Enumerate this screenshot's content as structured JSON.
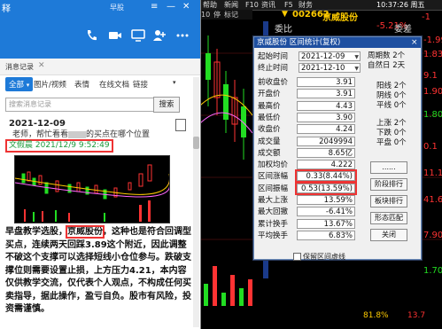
{
  "terminal": {
    "topbar": [
      "帮助",
      "新闻",
      "F10",
      "资讯",
      "F5",
      "财务"
    ],
    "toolbar2": [
      "10",
      "停",
      "标记"
    ],
    "clock": "10:37:26 周五",
    "stock_code": "002662",
    "stock_name": "京威股份",
    "weibi_label": "委比",
    "weibi_value": "-5.21%",
    "weicha_label": "委差",
    "right_values": [
      "-1.99",
      "1.83",
      "9.1",
      "1.90",
      "1.80",
      "0.1",
      "11.1",
      "41.6",
      "7.90",
      "1.70"
    ],
    "bottom_row": [
      "81.8%",
      "13.7"
    ],
    "red_up": "-1",
    "colors": {
      "bg": "#000000",
      "up": "#ff3333",
      "down": "#22dd22",
      "code": "#ffcc00"
    }
  },
  "chat": {
    "title": "释",
    "subtitle": "早股",
    "tab_label": "消息记录",
    "filter_tabs": [
      "全部",
      "图片/视频",
      "表情",
      "在线文档",
      "链接"
    ],
    "search_placeholder": "搜索消息记录",
    "search_button": "搜索",
    "date": "2021-12-09",
    "message_prefix": "老师，帮忙看看",
    "message_suffix": "的买点在哪个位置",
    "sender": "文假晨 2021/12/9 9:52:49",
    "body_before": "早盘教学选股，",
    "body_highlight": "京威股份",
    "body_after": "，这种也是符合回调型买点，连续两天回踩3.89这个附近，因此调整不破这个支撑可以选择短线小仓位参与。跌破支撑位则需要设置止损，上方压力4.21，本内容仅供教学交流，仅代表个人观点，不构成任何买卖指导，据此操作，盈亏自负。股市有风险，投资需谨慎。"
  },
  "dialog": {
    "title": "京威股份 区间统计(复权)",
    "close": "×",
    "start_label": "起始时间",
    "start_value": "2021-12-09",
    "end_label": "终止时间",
    "end_value": "2021-12-10",
    "fields": [
      {
        "label": "前收盘价",
        "value": "3.91"
      },
      {
        "label": "开盘价",
        "value": "3.91"
      },
      {
        "label": "最高价",
        "value": "4.43"
      },
      {
        "label": "最低价",
        "value": "3.90"
      },
      {
        "label": "收盘价",
        "value": "4.24"
      },
      {
        "label": "成交量",
        "value": "2049994"
      },
      {
        "label": "成交额",
        "value": "8.65亿"
      },
      {
        "label": "加权均价",
        "value": "4.222"
      },
      {
        "label": "区间涨幅",
        "value": "0.33(8.44%)"
      },
      {
        "label": "区间振幅",
        "value": "0.53(13.59%)"
      },
      {
        "label": "最大上涨",
        "value": "13.59%"
      },
      {
        "label": "最大回撤",
        "value": "-6.41%"
      },
      {
        "label": "累计换手",
        "value": "13.67%"
      },
      {
        "label": "平均换手",
        "value": "6.83%"
      }
    ],
    "right_info": [
      "周期数 2个",
      "自然日 2天",
      "阳线 2个",
      "阴线 0个",
      "平线 0个",
      "上涨 2个",
      "下跌 0个",
      "平盘 0个"
    ],
    "buttons": [
      "......",
      "阶段排行",
      "板块排行",
      "形态匹配",
      "关闭"
    ],
    "checkbox_label": "保留区间虚线"
  }
}
